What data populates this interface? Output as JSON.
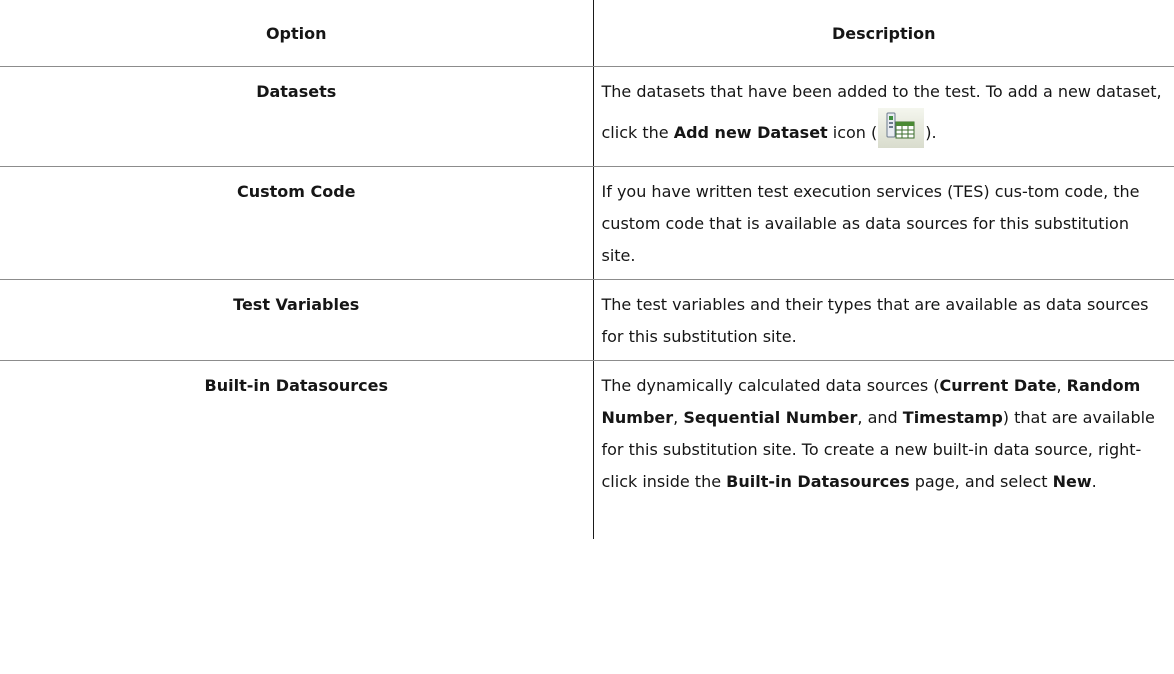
{
  "table": {
    "header": {
      "option": "Option",
      "description": "Description"
    },
    "rows": [
      {
        "option": "Datasets",
        "desc": {
          "t1": "The datasets that have been added to the test. To add a new dataset, click the ",
          "b1": "Add new Dataset",
          "t2": " icon (",
          "icon": "add-new-dataset-icon",
          "t3": ")."
        }
      },
      {
        "option": "Custom Code",
        "desc": {
          "t1": "If you have written test execution services (TES) cus-tom code, the custom code that is available as data sources for this substitution site."
        }
      },
      {
        "option": "Test Variables",
        "desc": {
          "t1": "The test variables and their types that are available as data sources for this substitution site."
        }
      },
      {
        "option": "Built-in Datasources",
        "desc": {
          "t1": "The dynamically calculated data sources (",
          "b1": "Current Date",
          "t2": ", ",
          "b2": "Random Number",
          "t3": ", ",
          "b3": "Sequential Number",
          "t4": ", and ",
          "b4": "Timestamp",
          "t5": ") that are available for this substitution site. To create a new built-in data source, right-click inside the ",
          "b5": "Built-in Datasources",
          "t6": " page, and select ",
          "b6": "New",
          "t7": "."
        }
      }
    ]
  },
  "colors": {
    "text": "#161616",
    "row_divider": "#8c8c8c",
    "column_divider": "#1a1a1a"
  }
}
